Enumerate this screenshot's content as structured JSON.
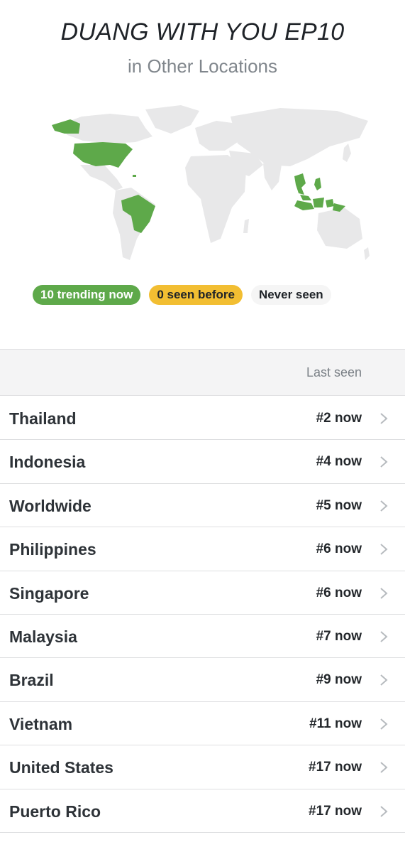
{
  "header": {
    "title": "DUANG WITH YOU EP10",
    "subtitle": "in Other Locations"
  },
  "map": {
    "highlighted_regions": [
      "Thailand",
      "Indonesia",
      "Philippines",
      "Singapore",
      "Malaysia",
      "Brazil",
      "Vietnam",
      "United States",
      "Puerto Rico"
    ],
    "colors": {
      "trending": "#5ea94a",
      "base": "#e8e8e9"
    }
  },
  "legend": {
    "trending_label": "10 trending now",
    "seen_before_label": "0 seen before",
    "never_seen_label": "Never seen",
    "colors": {
      "trending": "#5ea94a",
      "seen_before": "#f2be32",
      "never_seen": "#f5f5f5"
    }
  },
  "table": {
    "column_header": "Last seen",
    "rows": [
      {
        "name": "Thailand",
        "rank": "#2 now"
      },
      {
        "name": "Indonesia",
        "rank": "#4 now"
      },
      {
        "name": "Worldwide",
        "rank": "#5 now"
      },
      {
        "name": "Philippines",
        "rank": "#6 now"
      },
      {
        "name": "Singapore",
        "rank": "#6 now"
      },
      {
        "name": "Malaysia",
        "rank": "#7 now"
      },
      {
        "name": "Brazil",
        "rank": "#9 now"
      },
      {
        "name": "Vietnam",
        "rank": "#11 now"
      },
      {
        "name": "United States",
        "rank": "#17 now"
      },
      {
        "name": "Puerto Rico",
        "rank": "#17 now"
      }
    ],
    "row_icon": "chevron-right-icon"
  }
}
